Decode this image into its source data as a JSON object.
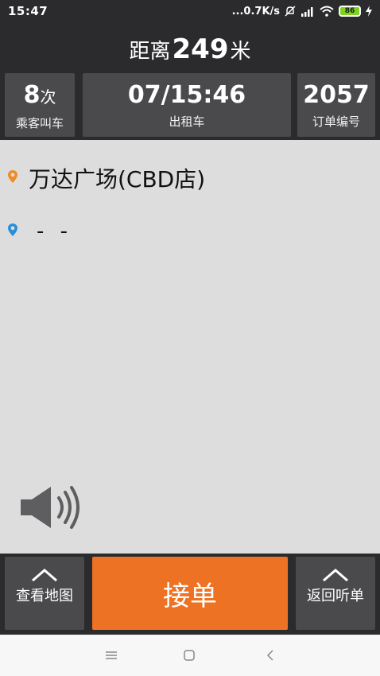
{
  "status_bar": {
    "time": "15:47",
    "network_speed": "...0.7K/s",
    "battery": "86"
  },
  "header": {
    "distance_prefix": "距离",
    "distance_value": "249",
    "distance_unit": "米",
    "boxes": {
      "left": {
        "value": "8",
        "unit": "次",
        "label": "乘客叫车"
      },
      "middle": {
        "value": "07/15:46",
        "label": "出租车"
      },
      "right": {
        "value": "2057",
        "label": "订单编号"
      }
    }
  },
  "route": {
    "start": "万达广场(CBD店)",
    "end": "- -"
  },
  "actions": {
    "map_label": "查看地图",
    "accept_label": "接单",
    "return_label": "返回听单"
  },
  "colors": {
    "accent": "#ee7223",
    "dark_bg": "#2b2b2d",
    "panel": "#4a4a4c",
    "content_bg": "#dcdddc",
    "start_pin": "#f08a24",
    "end_pin": "#2a8fd8"
  },
  "icons": {
    "start": "location-pin-orange",
    "end": "location-pin-blue",
    "speaker": "speaker-volume",
    "chevron": "chevron-up"
  }
}
